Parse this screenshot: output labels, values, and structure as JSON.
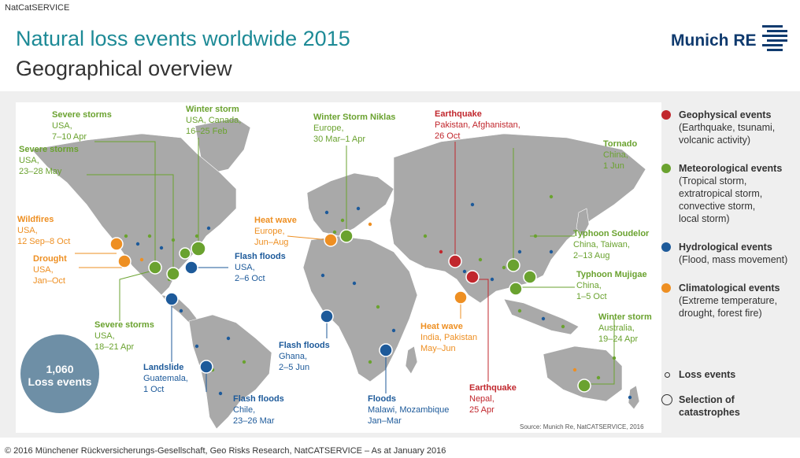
{
  "header": {
    "service": "NatCatSERVICE",
    "title": "Natural loss events worldwide 2015",
    "subtitle": "Geographical overview",
    "logo_text": "Munich RE"
  },
  "colors": {
    "geophysical": "#c1272d",
    "meteorological": "#6aa22f",
    "hydrological": "#1d5a9a",
    "climatological": "#ee8f22",
    "land": "#a9a9a9",
    "bubble": "#6e8fa6"
  },
  "annotations": [
    {
      "title": "Severe storms",
      "lines": [
        "USA,",
        "7–10 Apr"
      ],
      "cat": "met"
    },
    {
      "title": "Severe storms",
      "lines": [
        "USA,",
        "23–28 May"
      ],
      "cat": "met"
    },
    {
      "title": "Winter storm",
      "lines": [
        "USA, Canada,",
        "16–25 Feb"
      ],
      "cat": "met"
    },
    {
      "title": "Wildfires",
      "lines": [
        "USA,",
        "12 Sep–8 Oct"
      ],
      "cat": "cli"
    },
    {
      "title": "Drought",
      "lines": [
        "USA,",
        "Jan–Oct"
      ],
      "cat": "cli"
    },
    {
      "title": "Flash floods",
      "lines": [
        "USA,",
        "2–6 Oct"
      ],
      "cat": "hyd"
    },
    {
      "title": "Severe storms",
      "lines": [
        "USA,",
        "18–21 Apr"
      ],
      "cat": "met"
    },
    {
      "title": "Landslide",
      "lines": [
        "Guatemala,",
        "1 Oct"
      ],
      "cat": "hyd"
    },
    {
      "title": "Flash floods",
      "lines": [
        "Chile,",
        "23–26 Mar"
      ],
      "cat": "hyd"
    },
    {
      "title": "Winter Storm Niklas",
      "lines": [
        "Europe,",
        "30 Mar–1 Apr"
      ],
      "cat": "met"
    },
    {
      "title": "Heat wave",
      "lines": [
        "Europe,",
        "Jun–Aug"
      ],
      "cat": "cli"
    },
    {
      "title": "Flash floods",
      "lines": [
        "Ghana,",
        "2–5 Jun"
      ],
      "cat": "hyd"
    },
    {
      "title": "Floods",
      "lines": [
        "Malawi, Mozambique",
        "Jan–Mar"
      ],
      "cat": "hyd"
    },
    {
      "title": "Earthquake",
      "lines": [
        "Pakistan, Afghanistan,",
        "26 Oct"
      ],
      "cat": "geo"
    },
    {
      "title": "Heat wave",
      "lines": [
        "India, Pakistan",
        "May–Jun"
      ],
      "cat": "cli"
    },
    {
      "title": "Earthquake",
      "lines": [
        "Nepal,",
        "25 Apr"
      ],
      "cat": "geo"
    },
    {
      "title": "Tornado",
      "lines": [
        "China,",
        "1 Jun"
      ],
      "cat": "met"
    },
    {
      "title": "Typhoon Soudelor",
      "lines": [
        "China, Taiwan,",
        "2–13 Aug"
      ],
      "cat": "met"
    },
    {
      "title": "Typhoon Mujigae",
      "lines": [
        "China,",
        "1–5 Oct"
      ],
      "cat": "met"
    },
    {
      "title": "Winter storm",
      "lines": [
        "Australia,",
        "19–24 Apr"
      ],
      "cat": "met"
    }
  ],
  "total": {
    "count": "1,060",
    "label": "Loss events"
  },
  "legend": {
    "categories": [
      {
        "title": "Geophysical events",
        "desc": [
          "(Earthquake, tsunami,",
          "volcanic activity)"
        ],
        "cat": "geo"
      },
      {
        "title": "Meteorological events",
        "desc": [
          "(Tropical storm,",
          "extratropical storm,",
          "convective storm,",
          "local storm)"
        ],
        "cat": "met"
      },
      {
        "title": "Hydrological events",
        "desc": [
          "(Flood, mass movement)"
        ],
        "cat": "hyd"
      },
      {
        "title": "Climatological events",
        "desc": [
          "(Extreme temperature,",
          "drought, forest fire)"
        ],
        "cat": "cli"
      }
    ],
    "loss_events": "Loss events",
    "selection": [
      "Selection of",
      "catastrophes"
    ]
  },
  "source": "Source: Munich Re, NatCATSERVICE, 2016",
  "footer": "© 2016 Münchener Rückversicherungs-Gesellschaft, Geo Risks Research, NatCATSERVICE – As at January 2016"
}
